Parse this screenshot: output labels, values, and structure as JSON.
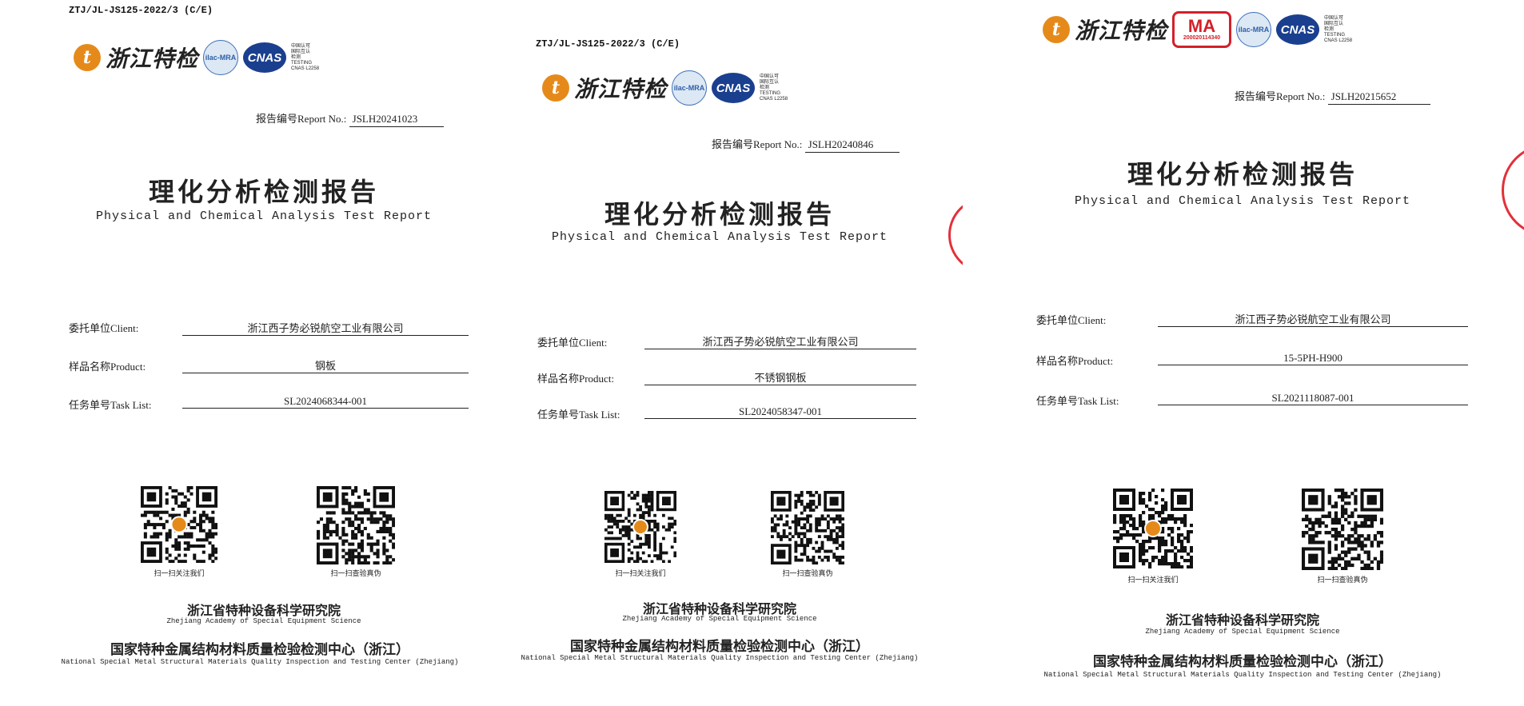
{
  "report_code": "ZTJ/JL-JS125-2022/3 (C/E)",
  "logo": {
    "brand_cn": "浙江特检",
    "icon": "zhejiang-tejian-logo-icon",
    "ilac": "ilac-MRA",
    "cnas": "CNAS",
    "cnas_side": [
      "中国认可",
      "国际互认",
      "检测",
      "TESTING",
      "CNAS L2258"
    ],
    "ma": "MA",
    "ma_number": "200020114340"
  },
  "labels": {
    "report_no": "报告编号Report No.:",
    "client": "委托单位Client:",
    "product": "样品名称Product:",
    "task": "任务单号Task List:",
    "title_cn": "理化分析检测报告",
    "title_en": "Physical and Chemical Analysis Test Report",
    "qr_follow": "扫一扫关注我们",
    "qr_verify": "扫一扫查验真伪",
    "institute_cn": "浙江省特种设备科学研究院",
    "institute_en": "Zhejiang Academy of Special Equipment Science",
    "center_cn": "国家特种金属结构材料质量检验检测中心（浙江）",
    "center_en": "National Special Metal Structural Materials Quality Inspection and Testing Center (Zhejiang)"
  },
  "reports": [
    {
      "report_no": "JSLH20241023",
      "client": "浙江西子势必锐航空工业有限公司",
      "product": "钢板",
      "task": "SL2024068344-001"
    },
    {
      "report_no": "JSLH20240846",
      "client": "浙江西子势必锐航空工业有限公司",
      "product": "不锈钢钢板",
      "task": "SL2024058347-001"
    },
    {
      "report_no": "JSLH20215652",
      "client": "浙江西子势必锐航空工业有限公司",
      "product": "15-5PH-H900",
      "task": "SL2021118087-001"
    }
  ],
  "colors": {
    "seal_red": "#e3303a",
    "logo_orange": "#e58a1a",
    "cnas_blue": "#1b3f8f"
  }
}
